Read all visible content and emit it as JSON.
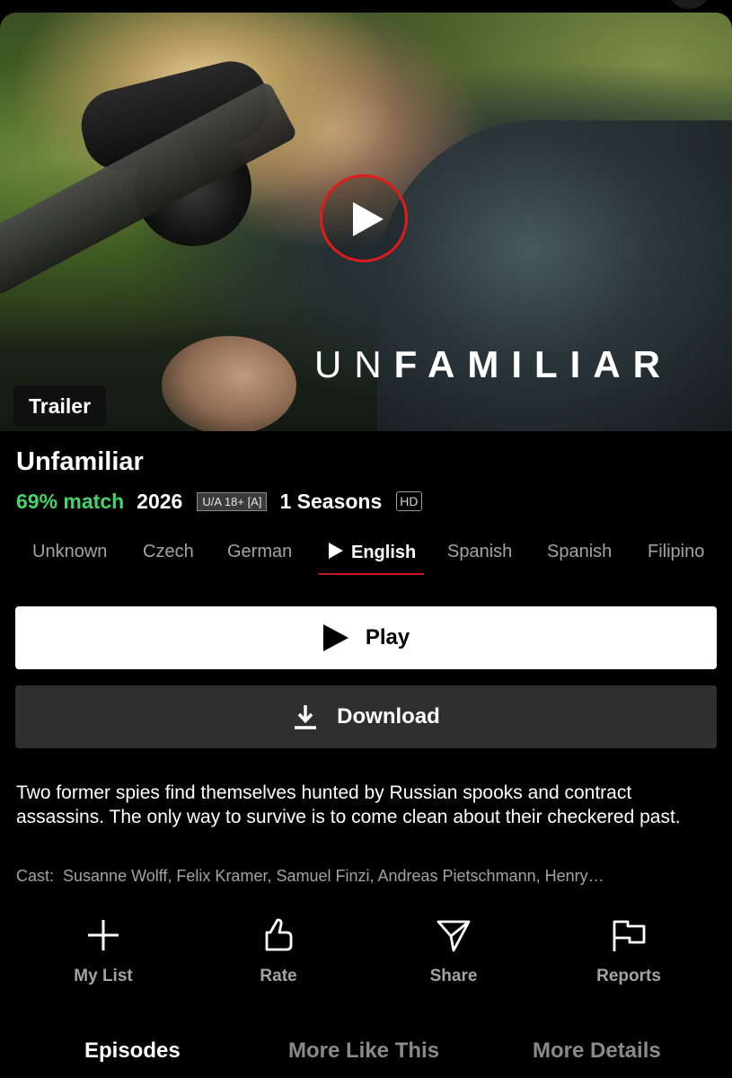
{
  "hero": {
    "brand_title_light": "UN",
    "brand_title_bold": "FAMILIAR",
    "trailer_badge": "Trailer"
  },
  "title": "Unfamiliar",
  "meta": {
    "match": "69% match",
    "year": "2026",
    "rating": "U/A 18+ [A]",
    "seasons": "1 Seasons",
    "quality": "HD"
  },
  "languages": {
    "items": [
      "Unknown",
      "Czech",
      "German",
      "English",
      "Spanish",
      "Spanish",
      "Filipino"
    ],
    "selected": "English"
  },
  "buttons": {
    "play": "Play",
    "download": "Download"
  },
  "synopsis": "Two former spies find themselves hunted by Russian spooks and contract assassins. The only way to survive is to come clean about their checkered past.",
  "cast": {
    "label": "Cast:",
    "names": "Susanne Wolff, Felix Kramer, Samuel Finzi, Andreas Pietschmann, Henry…"
  },
  "actions": [
    {
      "label": "My List",
      "icon": "plus-icon"
    },
    {
      "label": "Rate",
      "icon": "thumbs-up-icon"
    },
    {
      "label": "Share",
      "icon": "send-icon"
    },
    {
      "label": "Reports",
      "icon": "flag-icon"
    }
  ],
  "tabs": {
    "items": [
      "Episodes",
      "More Like This",
      "More Details"
    ],
    "active": "Episodes"
  },
  "colors": {
    "match": "#46d369",
    "accent": "#c8161d",
    "play_ring": "#e01b1b"
  }
}
